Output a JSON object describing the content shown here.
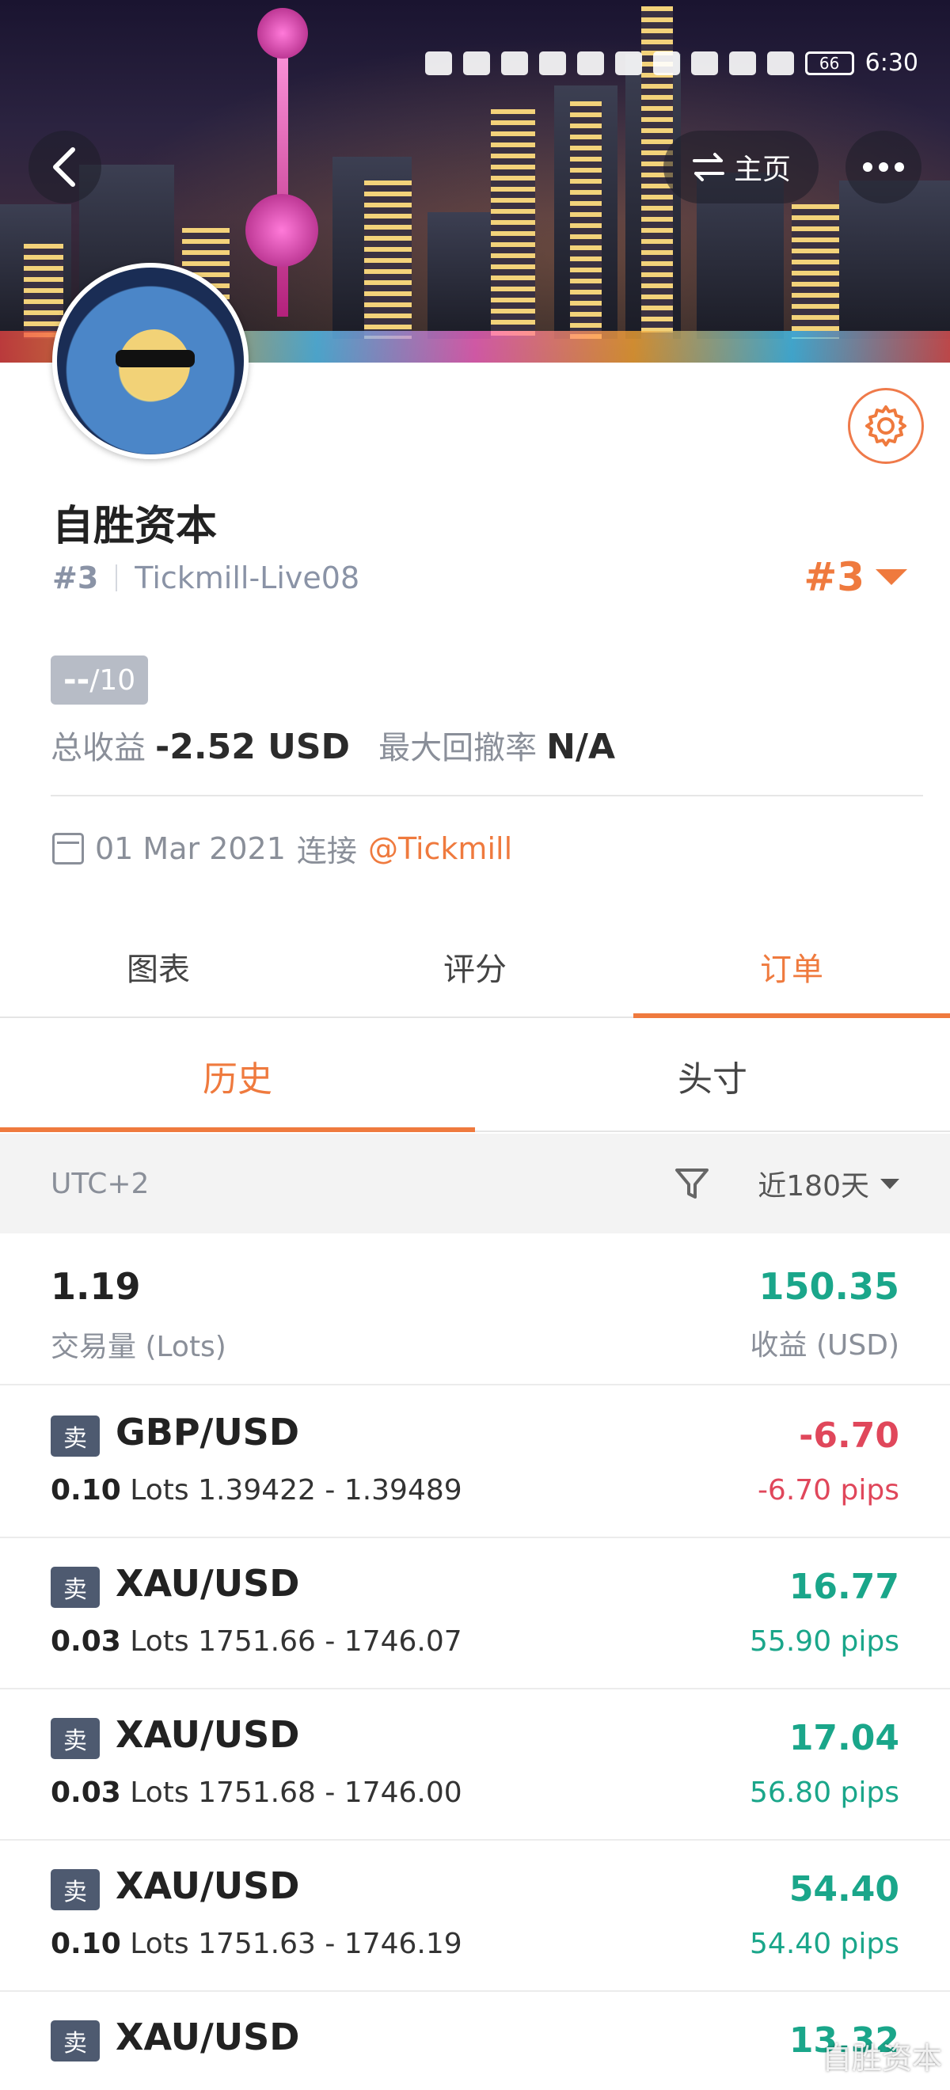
{
  "status_bar": {
    "time": "6:30",
    "battery": "66"
  },
  "nav": {
    "home_label": "主页"
  },
  "profile": {
    "name": "自胜资本",
    "rank_left": "#3",
    "account": "Tickmill-Live08",
    "rank_right": "#3",
    "score_value": "--",
    "score_suffix": "/10",
    "total_profit_label": "总收益",
    "total_profit_value": "-2.52 USD",
    "max_drawdown_label": "最大回撤率",
    "max_drawdown_value": "N/A",
    "connect_date": "01 Mar 2021",
    "connect_text": "连接",
    "broker_link": "@Tickmill"
  },
  "main_tabs": [
    {
      "label": "图表",
      "active": false
    },
    {
      "label": "评分",
      "active": false
    },
    {
      "label": "订单",
      "active": true
    }
  ],
  "sub_tabs": [
    {
      "label": "历史",
      "active": true
    },
    {
      "label": "头寸",
      "active": false
    }
  ],
  "filter": {
    "timezone": "UTC+2",
    "range": "近180天"
  },
  "summary": {
    "lots": "1.19",
    "lots_label": "交易量 (Lots)",
    "profit": "150.35",
    "profit_label": "收益 (USD)"
  },
  "orders": [
    {
      "side": "卖",
      "pair": "GBP/USD",
      "lots": "0.10",
      "lots_unit": "Lots",
      "prices": "1.39422 - 1.39489",
      "amount": "-6.70",
      "pips": "-6.70 pips",
      "positive": false
    },
    {
      "side": "卖",
      "pair": "XAU/USD",
      "lots": "0.03",
      "lots_unit": "Lots",
      "prices": "1751.66 - 1746.07",
      "amount": "16.77",
      "pips": "55.90 pips",
      "positive": true
    },
    {
      "side": "卖",
      "pair": "XAU/USD",
      "lots": "0.03",
      "lots_unit": "Lots",
      "prices": "1751.68 - 1746.00",
      "amount": "17.04",
      "pips": "56.80 pips",
      "positive": true
    },
    {
      "side": "卖",
      "pair": "XAU/USD",
      "lots": "0.10",
      "lots_unit": "Lots",
      "prices": "1751.63 - 1746.19",
      "amount": "54.40",
      "pips": "54.40 pips",
      "positive": true
    },
    {
      "side": "卖",
      "pair": "XAU/USD",
      "lots": "",
      "lots_unit": "",
      "prices": "",
      "amount": "13.32",
      "pips": "",
      "positive": true
    }
  ],
  "watermark": "自胜资本",
  "colors": {
    "accent": "#ef7a3e",
    "positive": "#1aa68a",
    "negative": "#e0475b"
  }
}
